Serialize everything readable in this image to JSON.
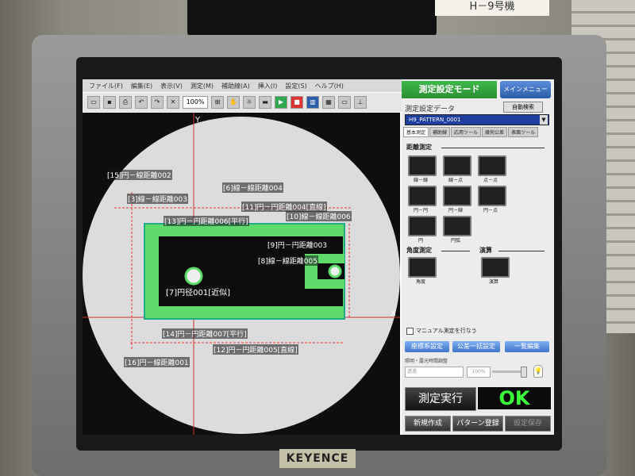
{
  "device_label": "H－9号機",
  "brand": "KEYENCE",
  "menu": [
    "ファイル(F)",
    "編集(E)",
    "表示(V)",
    "測定(M)",
    "補助線(A)",
    "挿入(I)",
    "設定(S)",
    "ヘルプ(H)"
  ],
  "toolbar": {
    "zoom_value": "100%"
  },
  "viewport": {
    "axis_y": "Y",
    "axis_x": "X",
    "labels": [
      "[15]円－線距離002",
      "[6]線－線距離004",
      "[3]線－線距離003",
      "[11]円－円距離004[直線]",
      "[13]円－円距離006[平行]",
      "[10]線－線距離006",
      "[9]円－円距離003",
      "[8]線－線距離005",
      "[7]円径001[近似]",
      "[14]円－円距離007[平行]",
      "[12]円－円距離005[直線]",
      "[16]円－線距離001"
    ]
  },
  "panel": {
    "mode_title": "測定設定モード",
    "main_menu": "メインメニュー",
    "data_title": "測定設定データ",
    "auto_select": "自動検索",
    "selected_file": "H9_PATTERN_0001",
    "tabs": [
      "基本測定",
      "補助線",
      "応用ツール",
      "幾何公差",
      "表面ツール"
    ],
    "distance_section": "距離測定",
    "tool_labels": [
      "線－線",
      "線－点",
      "点－点",
      "円－円",
      "円－線",
      "円－点",
      "円",
      "円弧"
    ],
    "angle_section": "角度測定",
    "calc_section": "演算",
    "angle_label": "角度",
    "calc_label": "演算",
    "manual_check": "マニュアル測定を行なう",
    "btn_coord": "座標系設定",
    "btn_tolerance": "公差一括設定",
    "btn_list": "一覧編集",
    "light_label": "照明・露光時間調整",
    "light_select": "透過",
    "light_pct": "100%",
    "run_button": "測定実行",
    "result": "OK",
    "btn_new": "新規作成",
    "btn_register": "パターン登録",
    "btn_save": "設定保存"
  }
}
